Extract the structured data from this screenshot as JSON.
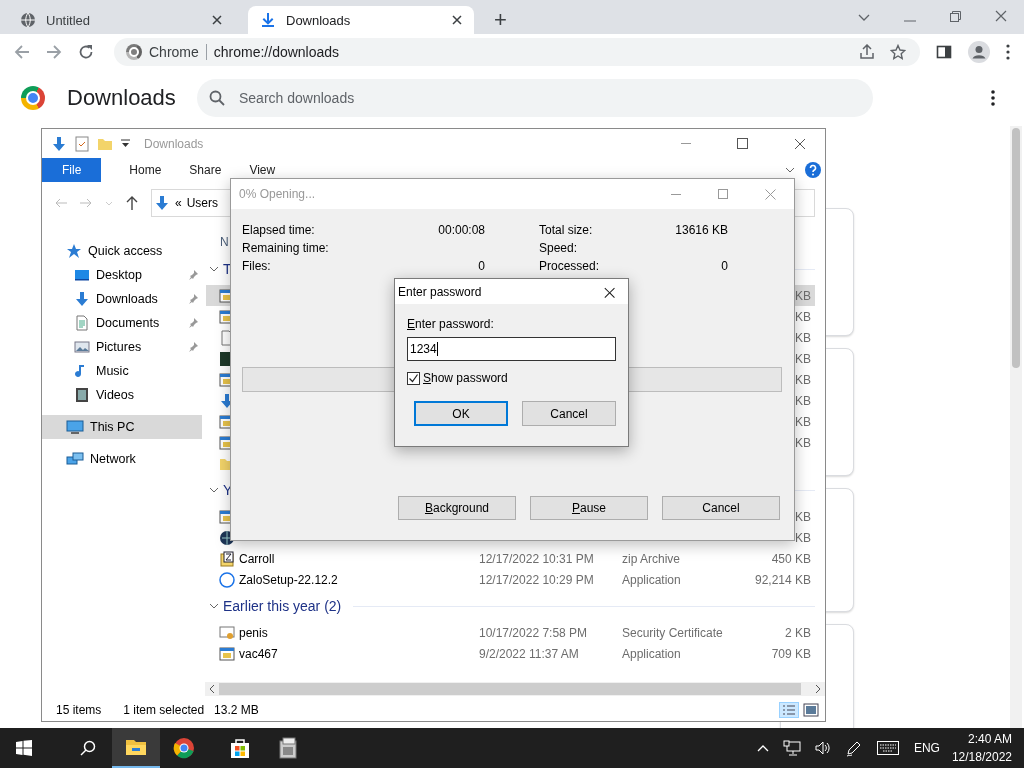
{
  "browser": {
    "tabs": [
      {
        "title": "Untitled",
        "selected": false
      },
      {
        "title": "Downloads",
        "selected": true
      }
    ],
    "new_tab": "+",
    "site_chip": "Chrome",
    "url": "chrome://downloads",
    "page_title": "Downloads",
    "search": {
      "placeholder": "Search downloads"
    }
  },
  "explorer": {
    "title": "Downloads",
    "ribbon_tabs": [
      {
        "label": "File",
        "selected": true
      },
      {
        "label": "Home",
        "selected": false
      },
      {
        "label": "Share",
        "selected": false
      },
      {
        "label": "View",
        "selected": false
      }
    ],
    "address": [
      "«",
      "Users"
    ],
    "nav": [
      {
        "label": "Quick access",
        "selected": false,
        "children": [
          {
            "label": "Desktop",
            "pinned": true,
            "selected": false
          },
          {
            "label": "Downloads",
            "pinned": true,
            "selected": false
          },
          {
            "label": "Documents",
            "pinned": true,
            "selected": false
          },
          {
            "label": "Pictures",
            "pinned": true,
            "selected": false
          },
          {
            "label": "Music",
            "pinned": false,
            "selected": false
          },
          {
            "label": "Videos",
            "pinned": false,
            "selected": false
          }
        ]
      },
      {
        "label": "This PC",
        "selected": true
      },
      {
        "label": "Network",
        "selected": false
      }
    ],
    "column_header": "N",
    "groups": [
      {
        "label": "T",
        "rows": [
          {
            "size": "KB",
            "selected": true
          },
          {
            "size": "KB",
            "selected": false
          },
          {
            "size": "KB",
            "selected": false
          },
          {
            "size": "KB",
            "selected": false
          },
          {
            "size": "KB",
            "selected": false
          },
          {
            "size": "KB",
            "selected": false
          },
          {
            "size": "KB",
            "selected": false
          },
          {
            "size": "KB",
            "selected": false
          },
          {
            "selected": false
          }
        ]
      },
      {
        "label": "Y",
        "rows": [
          {
            "size": "KB",
            "selected": false
          },
          {
            "size": "KB",
            "selected": false
          },
          {
            "name": "Carroll",
            "date": "12/17/2022 10:31 PM",
            "type": "zip Archive",
            "size": "450 KB",
            "selected": false
          },
          {
            "name": "ZaloSetup-22.12.2",
            "date": "12/17/2022 10:29 PM",
            "type": "Application",
            "size": "92,214 KB",
            "selected": false
          }
        ]
      },
      {
        "label": "Earlier this year (2)",
        "rows": [
          {
            "name": "penis",
            "date": "10/17/2022 7:58 PM",
            "type": "Security Certificate",
            "size": "2 KB",
            "selected": false
          },
          {
            "name": "vac467",
            "date": "9/2/2022 11:37 AM",
            "type": "Application",
            "size": "709 KB",
            "selected": false
          }
        ]
      }
    ],
    "status": [
      "15 items",
      "1 item selected",
      "13.2 MB"
    ]
  },
  "progress_dialog": {
    "title": "0% Opening...",
    "stats": [
      {
        "label": "Elapsed time:",
        "value": "00:00:08",
        "label2": "Total size:",
        "value2": "13616 KB"
      },
      {
        "label": "Remaining time:",
        "label2": "Speed:"
      },
      {
        "label": "Files:",
        "value": "0",
        "label2": "Processed:",
        "value2": "0"
      }
    ],
    "level": 0,
    "buttons": [
      {
        "label": "Background",
        "mnemonic": true,
        "default": false
      },
      {
        "label": "Pause",
        "mnemonic": true,
        "default": false
      },
      {
        "label": "Cancel",
        "mnemonic": false,
        "default": false
      }
    ]
  },
  "password_dialog": {
    "title": "Enter password",
    "close": "×",
    "field_label": "Enter password:",
    "value": "1234",
    "show_password": {
      "label": "Show password",
      "checked": true
    },
    "buttons": [
      {
        "label": "OK",
        "mnemonic": false,
        "default": true
      },
      {
        "label": "Cancel",
        "mnemonic": false,
        "default": false
      }
    ]
  },
  "taskbar": {
    "apps": [
      {
        "active": true
      },
      {
        "active": false
      },
      {
        "active": false
      },
      {
        "active": false
      }
    ],
    "language": "ENG",
    "time": "2:40 AM",
    "date": "12/18/2022"
  }
}
